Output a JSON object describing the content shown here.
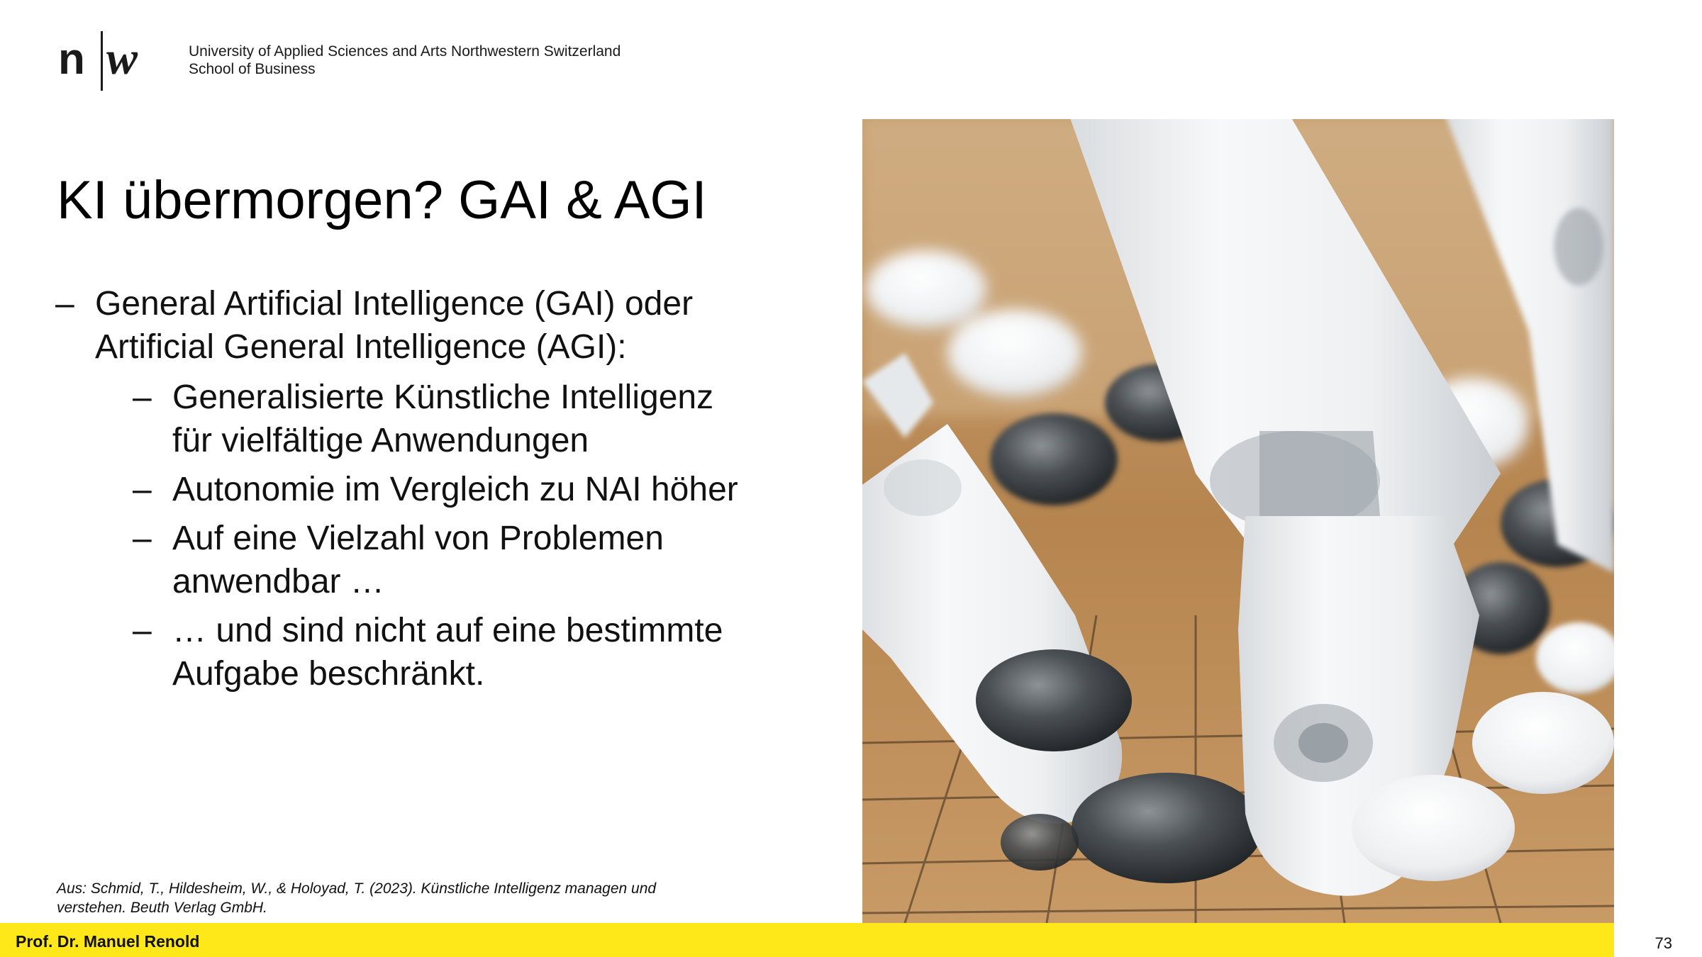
{
  "header": {
    "logo_letters": "n|w",
    "institution_line1": "University of Applied Sciences and Arts Northwestern Switzerland",
    "institution_line2": "School of Business"
  },
  "slide": {
    "title": "KI übermorgen? GAI & AGI",
    "bullet_dash": "–",
    "bullet_main": {
      "line1": "General Artificial Intelligence (GAI) oder",
      "line2": "Artificial General Intelligence (AGI):"
    },
    "sub_bullets": [
      {
        "line1": "Generalisierte Künstliche Intelligenz",
        "line2": "für vielfältige Anwendungen"
      },
      {
        "line1": "Autonomie im Vergleich zu NAI höher",
        "line2": ""
      },
      {
        "line1": "Auf eine Vielzahl von Problemen",
        "line2": "anwendbar …"
      },
      {
        "line1": "… und sind nicht auf eine bestimmte",
        "line2": "Aufgabe beschränkt."
      }
    ],
    "reference": {
      "line1": "Aus: Schmid, T., Hildesheim, W., & Holoyad, T. (2023). Künstliche Intelligenz managen und",
      "line2": "verstehen. Beuth Verlag GmbH."
    },
    "image_subject": "robot-hand-go-stones-photo"
  },
  "footer": {
    "author": "Prof. Dr. Manuel Renold",
    "page_number": "73",
    "bar_color": "#ffe81a"
  }
}
